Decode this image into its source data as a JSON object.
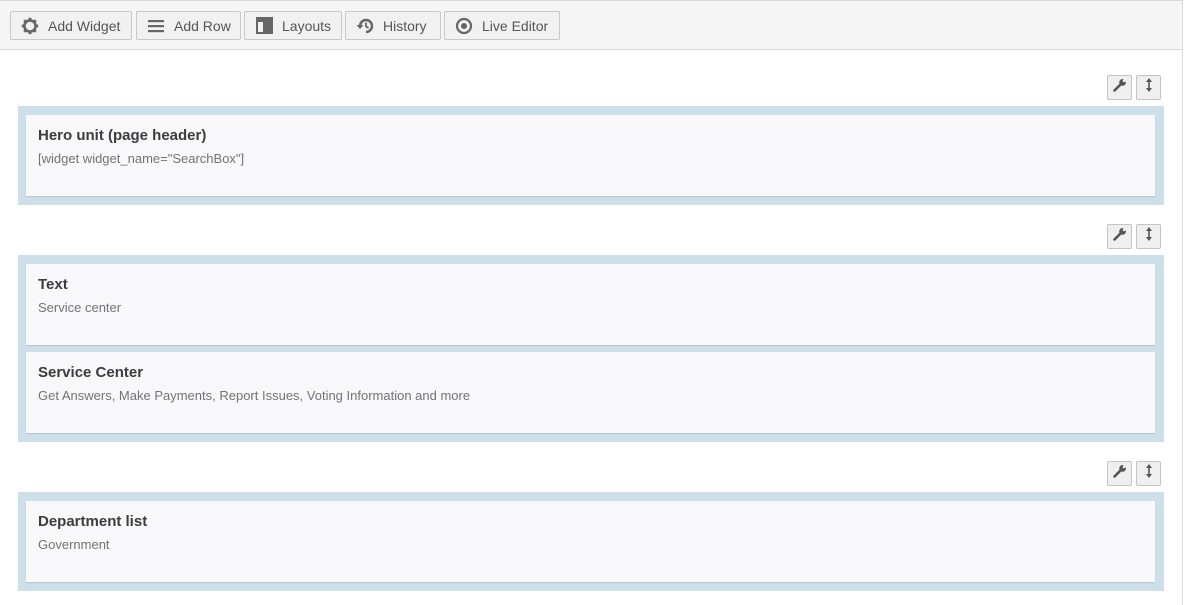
{
  "toolbar": {
    "buttons": [
      {
        "label": "Add Widget",
        "icon": "gear-icon"
      },
      {
        "label": "Add Row",
        "icon": "menu-lines-icon"
      },
      {
        "label": "Layouts",
        "icon": "layout-icon"
      },
      {
        "label": "History",
        "icon": "history-icon"
      },
      {
        "label": "Live Editor",
        "icon": "eye-icon"
      }
    ]
  },
  "rows": [
    {
      "tools": [
        "wrench-icon",
        "move-vertical-icon"
      ],
      "widgets": [
        {
          "title": "Hero unit (page header)",
          "description": "[widget widget_name=\"SearchBox\"]"
        }
      ]
    },
    {
      "tools": [
        "wrench-icon",
        "move-vertical-icon"
      ],
      "widgets": [
        {
          "title": "Text",
          "description": "Service center"
        },
        {
          "title": "Service Center",
          "description": "Get Answers, Make Payments, Report Issues, Voting Information and more"
        }
      ]
    },
    {
      "tools": [
        "wrench-icon",
        "move-vertical-icon"
      ],
      "widgets": [
        {
          "title": "Department list",
          "description": "Government"
        }
      ]
    }
  ],
  "colors": {
    "row_background": "#cde0ea",
    "widget_background": "#f8f8fa",
    "toolbar_background": "#f5f5f5"
  }
}
